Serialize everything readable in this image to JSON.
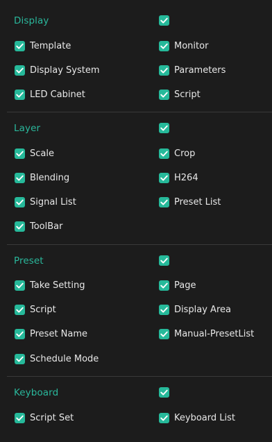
{
  "sections": [
    {
      "title": "Display",
      "items": [
        {
          "label": "Template"
        },
        {
          "label": "Monitor"
        },
        {
          "label": "Display System"
        },
        {
          "label": "Parameters"
        },
        {
          "label": "LED Cabinet"
        },
        {
          "label": "Script"
        }
      ]
    },
    {
      "title": "Layer",
      "items": [
        {
          "label": "Scale"
        },
        {
          "label": "Crop"
        },
        {
          "label": "Blending"
        },
        {
          "label": "H264"
        },
        {
          "label": "Signal List"
        },
        {
          "label": "Preset List"
        },
        {
          "label": "ToolBar"
        }
      ]
    },
    {
      "title": "Preset",
      "items": [
        {
          "label": "Take Setting"
        },
        {
          "label": "Page"
        },
        {
          "label": "Script"
        },
        {
          "label": "Display Area"
        },
        {
          "label": "Preset Name"
        },
        {
          "label": "Manual-PresetList"
        },
        {
          "label": "Schedule Mode"
        }
      ]
    },
    {
      "title": "Keyboard",
      "items": [
        {
          "label": "Script Set"
        },
        {
          "label": "Keyboard List"
        }
      ]
    }
  ],
  "colors": {
    "accent": "#26b99a",
    "section_title": "#2ab89c",
    "label": "#e8e8e8",
    "background": "#1c1c1c",
    "divider": "#3a3a3a"
  }
}
